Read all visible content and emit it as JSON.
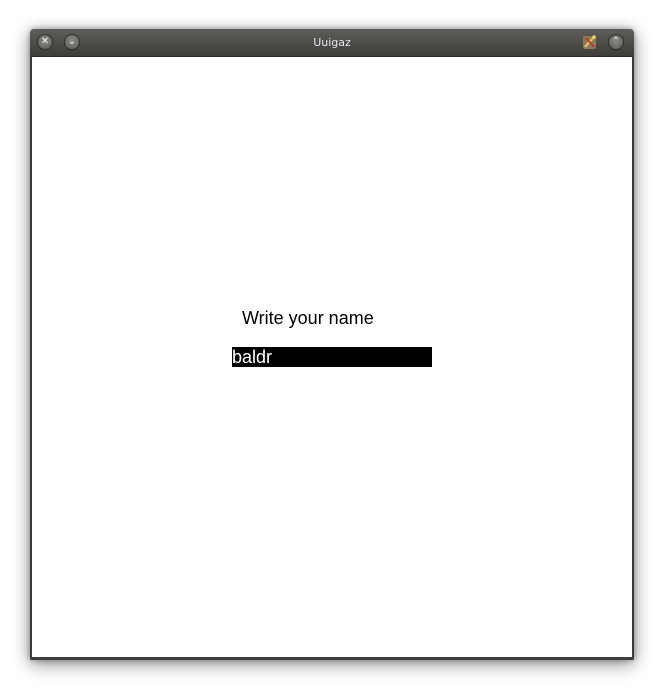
{
  "window": {
    "title": "Uuigaz",
    "buttons": {
      "close_icon": "close-icon",
      "menu_icon": "chevron-down-icon",
      "maximize_icon": "double-chevron-up-icon"
    },
    "app_icon": "paint-tools-icon"
  },
  "form": {
    "prompt": "Write your name",
    "name_value": "baldr"
  },
  "colors": {
    "titlebar": "#4a4846",
    "input_bg": "#000000",
    "input_text": "#ffffff"
  }
}
